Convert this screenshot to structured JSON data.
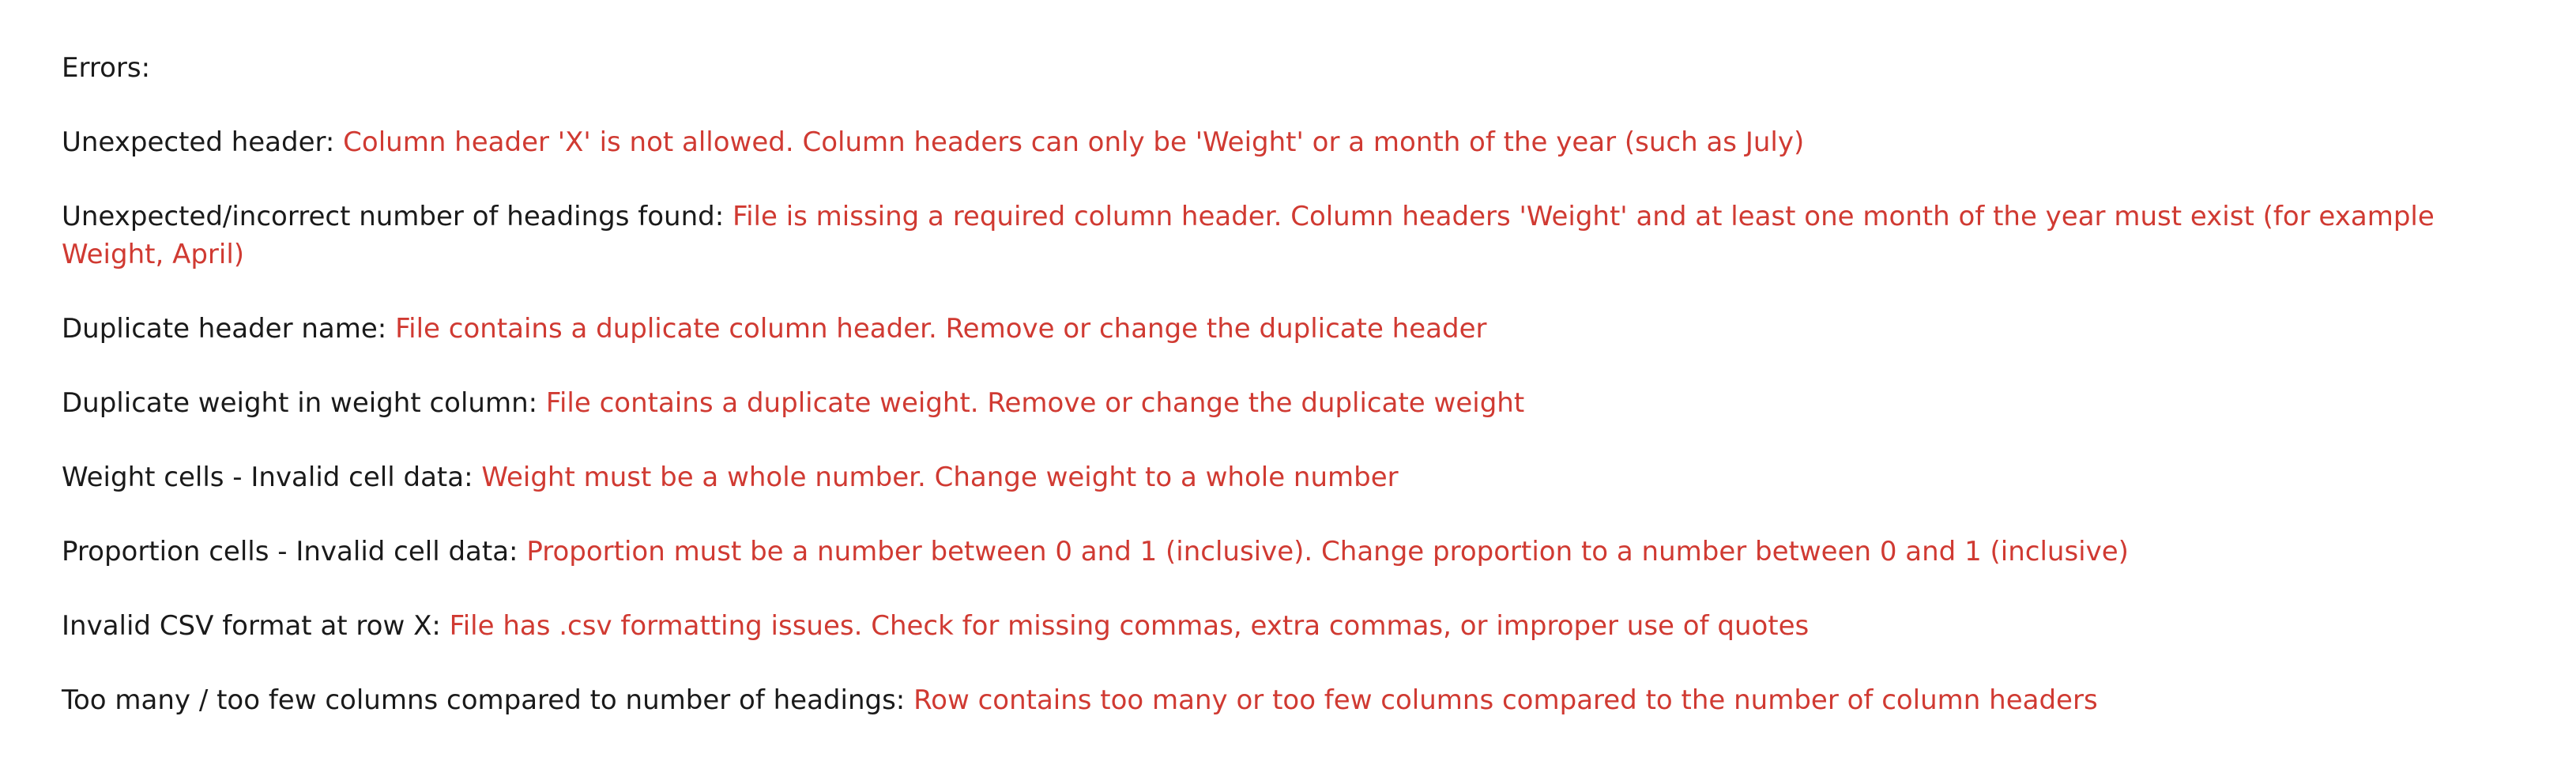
{
  "heading": "Errors:",
  "colors": {
    "label": "#1a1a1a",
    "message": "#d03a32",
    "background": "#ffffff"
  },
  "errors": [
    {
      "title": "Unexpected header:",
      "message": "Column header 'X' is not allowed. Column headers can only be 'Weight' or a month of the year (such as July)"
    },
    {
      "title": "Unexpected/incorrect number of headings found:",
      "message": "File is missing a required column header. Column headers 'Weight' and at least one month of the year must exist (for example Weight, April)"
    },
    {
      "title": "Duplicate header name:",
      "message": "File contains a duplicate column header. Remove or change the duplicate header"
    },
    {
      "title": "Duplicate weight in weight column:",
      "message": "File contains a duplicate weight. Remove or change the duplicate weight"
    },
    {
      "title": "Weight cells - Invalid cell data:",
      "message": "Weight must be a whole number. Change weight to a whole number"
    },
    {
      "title": "Proportion cells - Invalid cell data:",
      "message": "Proportion must be a number between 0 and 1 (inclusive). Change proportion to a number between 0 and 1 (inclusive)"
    },
    {
      "title": "Invalid CSV format at row X:",
      "message": "File has .csv formatting issues. Check for missing commas, extra commas, or improper use of quotes"
    },
    {
      "title": "Too many / too few columns compared to number of headings:",
      "message": "Row contains too many or too few columns compared to the number of column headers"
    }
  ]
}
